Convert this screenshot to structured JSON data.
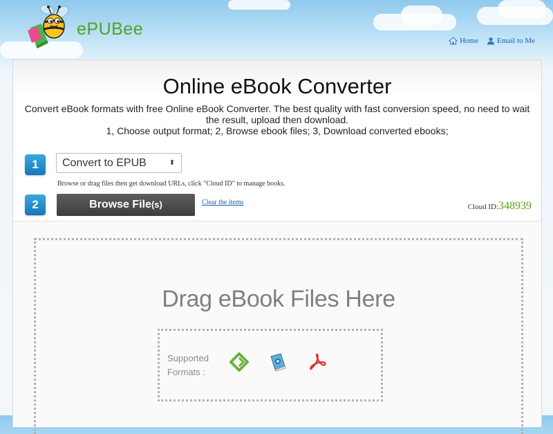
{
  "brand": {
    "name": "ePUBee"
  },
  "nav": {
    "home": "Home",
    "email": "Email to Me"
  },
  "hero": {
    "title": "Online eBook Converter",
    "description": "Convert eBook formats with free Online eBook Converter. The best quality with fast conversion speed, no need to wait the result, upload then download.",
    "steps_text": "1, Choose output format; 2, Browse ebook files; 3, Download converted ebooks;"
  },
  "step1": {
    "number": "1",
    "selected_format": "Convert to EPUB",
    "select_arrow": "⬍"
  },
  "hint": "Browse or drag files then get download URLs, click \"Cloud ID\" to manage books.",
  "step2": {
    "number": "2",
    "browse_label": "Browse File",
    "browse_suffix": "(s)",
    "clear_label": "Clear the items"
  },
  "cloud": {
    "label": "Cloud ID:",
    "id": "348939"
  },
  "dropzone": {
    "title": "Drag eBook Files Here",
    "formats_line1": "Supported",
    "formats_line2": "Formats :"
  },
  "icons": [
    "epub-icon",
    "mobi-book-icon",
    "pdf-icon"
  ],
  "colors": {
    "brand_green": "#4ea321",
    "link_blue": "#1f5ea8",
    "step_blue": "#1677b8",
    "cloud_id_green": "#5a9e1c",
    "pdf_red": "#e0312b"
  }
}
